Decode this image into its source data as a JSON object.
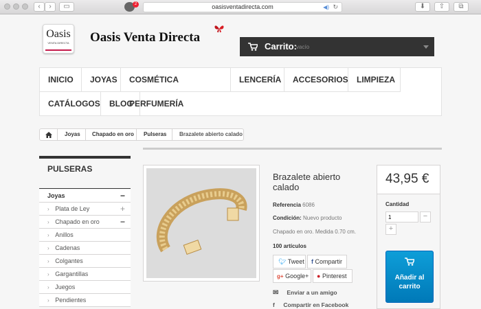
{
  "browser": {
    "url": "oasisventadirecta.com",
    "badge_count": "2"
  },
  "header": {
    "logo_text": "Oasis",
    "logo_subtext": "VENTA DIRECTA",
    "site_name": "Oasis Venta Directa",
    "cart_label": "Carrito:",
    "cart_value": "vacío"
  },
  "nav": {
    "items": [
      "Inicio",
      "Joyas",
      "Cosmética Perfumería",
      "Lencería",
      "Accesorios",
      "Limpieza",
      "Catálogos",
      "Blog"
    ]
  },
  "breadcrumb": {
    "items": [
      "Joyas",
      "Chapado en oro",
      "Pulseras",
      "Brazalete abierto calado"
    ]
  },
  "sidebar": {
    "title": "Pulseras",
    "items": [
      {
        "label": "Joyas",
        "toggle": "−"
      },
      {
        "label": "Plata de Ley",
        "toggle": "+"
      },
      {
        "label": "Chapado en oro",
        "toggle": "−"
      },
      {
        "label": "Anillos",
        "toggle": ""
      },
      {
        "label": "Cadenas",
        "toggle": ""
      },
      {
        "label": "Colgantes",
        "toggle": ""
      },
      {
        "label": "Gargantillas",
        "toggle": ""
      },
      {
        "label": "Juegos",
        "toggle": ""
      },
      {
        "label": "Pendientes",
        "toggle": ""
      }
    ]
  },
  "product": {
    "title": "Brazalete abierto calado",
    "reference_label": "Referencia",
    "reference_value": "6086",
    "condition_label": "Condición:",
    "condition_value": "Nuevo producto",
    "description": "Chapado en oro. Medida 0.70 cm.",
    "stock": "100 artículos",
    "share": {
      "tweet": "Tweet",
      "facebook": "Compartir",
      "google": "Google+",
      "pinterest": "Pinterest"
    },
    "send_friend": "Enviar a un amigo",
    "share_facebook": "Compartir en Facebook"
  },
  "buy": {
    "price": "43,95 €",
    "quantity_label": "Cantidad",
    "quantity_value": "1",
    "add_to_cart": "Añadir al carrito"
  },
  "colors": {
    "dark": "#333333",
    "accent_blue": "#0e8fcf",
    "brand_red": "#c41a4a"
  }
}
